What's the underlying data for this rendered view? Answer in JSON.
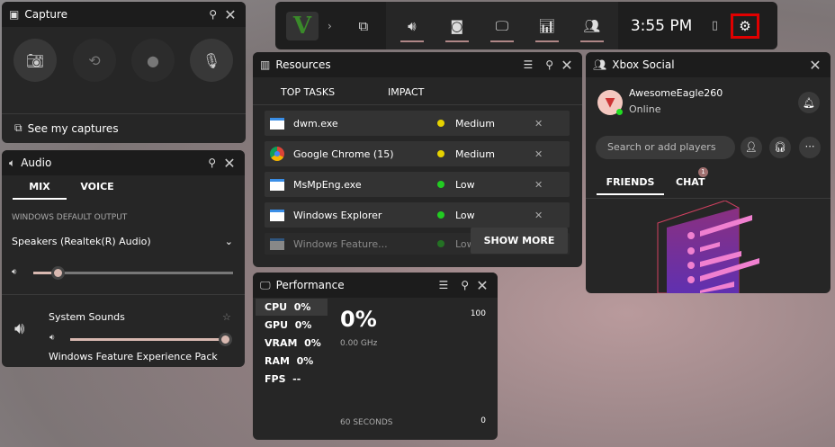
{
  "capture": {
    "title": "Capture",
    "see_captures": "See my captures"
  },
  "audio": {
    "title": "Audio",
    "tabs": [
      "MIX",
      "VOICE"
    ],
    "output_label": "WINDOWS DEFAULT OUTPUT",
    "device": "Speakers (Realtek(R) Audio)",
    "master_volume": 0.12,
    "apps": [
      {
        "name": "System Sounds",
        "volume": 1.0
      },
      {
        "name": "Windows Feature Experience Pack"
      }
    ]
  },
  "topbar": {
    "game": "V",
    "time": "3:55 PM"
  },
  "resources": {
    "title": "Resources",
    "cols": [
      "TOP TASKS",
      "IMPACT"
    ],
    "rows": [
      {
        "name": "dwm.exe",
        "impact": "Medium",
        "color": "#e6d200"
      },
      {
        "name": "Google Chrome (15)",
        "impact": "Medium",
        "color": "#e6d200"
      },
      {
        "name": "MsMpEng.exe",
        "impact": "Low",
        "color": "#22cc22"
      },
      {
        "name": "Windows Explorer",
        "impact": "Low",
        "color": "#22cc22"
      },
      {
        "name": "Windows Feature...",
        "impact": "Low",
        "color": "#22cc22"
      }
    ],
    "show_more": "SHOW MORE"
  },
  "performance": {
    "title": "Performance",
    "stats": [
      {
        "label": "CPU",
        "value": "0%"
      },
      {
        "label": "GPU",
        "value": "0%"
      },
      {
        "label": "VRAM",
        "value": "0%"
      },
      {
        "label": "RAM",
        "value": "0%"
      },
      {
        "label": "FPS",
        "value": "--"
      }
    ],
    "big": "0%",
    "freq": "0.00 GHz",
    "max": "100",
    "min": "0",
    "span": "60 SECONDS"
  },
  "social": {
    "title": "Xbox Social",
    "user": "AwesomeEagle260",
    "status": "Online",
    "search_placeholder": "Search or add players",
    "tabs": [
      "FRIENDS",
      "CHAT"
    ],
    "chat_badge": "1"
  }
}
